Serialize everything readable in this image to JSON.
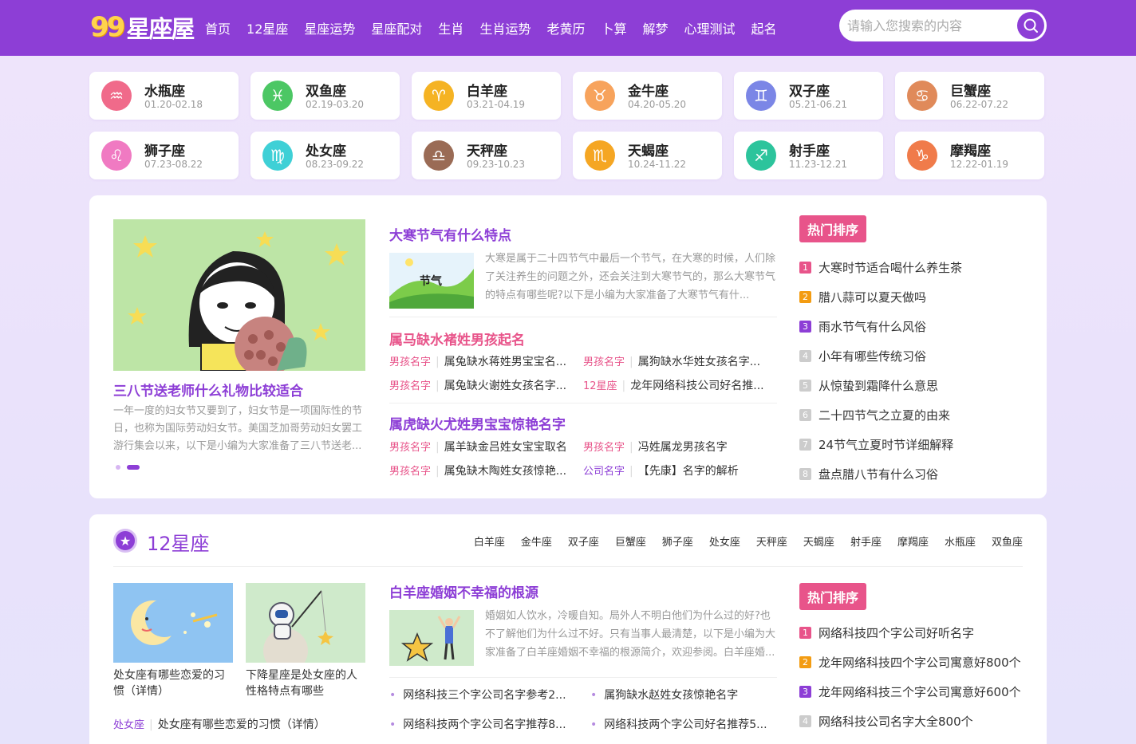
{
  "header": {
    "logo_num": "99",
    "logo_text": "星座屋",
    "nav": [
      "首页",
      "12星座",
      "星座运势",
      "星座配对",
      "生肖",
      "生肖运势",
      "老黄历",
      "卜算",
      "解梦",
      "心理测试",
      "起名"
    ],
    "search_placeholder": "请输入您搜索的内容"
  },
  "zodiac": [
    {
      "name": "水瓶座",
      "date": "01.20-02.18",
      "color": "#f06a8a",
      "glyph": "♒"
    },
    {
      "name": "双鱼座",
      "date": "02.19-03.20",
      "color": "#4cc764",
      "glyph": "♓"
    },
    {
      "name": "白羊座",
      "date": "03.21-04.19",
      "color": "#f5b323",
      "glyph": "♈"
    },
    {
      "name": "金牛座",
      "date": "04.20-05.20",
      "color": "#f7a35c",
      "glyph": "♉"
    },
    {
      "name": "双子座",
      "date": "05.21-06.21",
      "color": "#7b86e6",
      "glyph": "♊"
    },
    {
      "name": "巨蟹座",
      "date": "06.22-07.22",
      "color": "#e08a5a",
      "glyph": "♋"
    },
    {
      "name": "狮子座",
      "date": "07.23-08.22",
      "color": "#f07ac2",
      "glyph": "♌"
    },
    {
      "name": "处女座",
      "date": "08.23-09.22",
      "color": "#3fd0d6",
      "glyph": "♍"
    },
    {
      "name": "天秤座",
      "date": "09.23-10.23",
      "color": "#9a6b55",
      "glyph": "♎"
    },
    {
      "name": "天蝎座",
      "date": "10.24-11.22",
      "color": "#f5a623",
      "glyph": "♏"
    },
    {
      "name": "射手座",
      "date": "11.23-12.21",
      "color": "#2cc49c",
      "glyph": "♐"
    },
    {
      "name": "摩羯座",
      "date": "12.22-01.19",
      "color": "#f07b4a",
      "glyph": "♑"
    }
  ],
  "featured": {
    "title": "三八节送老师什么礼物比较适合",
    "desc": "一年一度的妇女节又要到了，妇女节是一项国际性的节日，也称为国际劳动妇女节。美国芝加哥劳动妇女罢工游行集会以来，以下是小编为大家准备了三八节送老..."
  },
  "articles": {
    "a1": {
      "title": "大寒节气有什么特点",
      "desc": "大寒是属于二十四节气中最后一个节气，在大寒的时候，人们除了关注养生的问题之外，还会关注到大寒节气的，那么大寒节气的特点有哪些呢?以下是小编为大家准备了大寒节气有什..."
    },
    "a2": {
      "title": "属马缺水褚姓男孩起名"
    },
    "a2_rows": [
      [
        {
          "tag": "男孩名字",
          "text": "属兔缺水蒋姓男宝宝名..."
        },
        {
          "tag": "男孩名字",
          "text": "属狗缺水华姓女孩名字..."
        }
      ],
      [
        {
          "tag": "男孩名字",
          "text": "属兔缺火谢姓女孩名字..."
        },
        {
          "tag": "12星座",
          "text": "龙年网络科技公司好名推..."
        }
      ]
    ],
    "a3": {
      "title": "属虎缺火尤姓男宝宝惊艳名字"
    },
    "a3_rows": [
      [
        {
          "tag": "男孩名字",
          "text": "属羊缺金吕姓女宝宝取名"
        },
        {
          "tag": "男孩名字",
          "text": "冯姓属龙男孩名字"
        }
      ],
      [
        {
          "tag": "男孩名字",
          "text": "属兔缺木陶姓女孩惊艳..."
        },
        {
          "tag": "公司名字",
          "text": "【先康】名字的解析"
        }
      ]
    ]
  },
  "hot1": {
    "badge": "热门排序",
    "items": [
      "大寒时节适合喝什么养生茶",
      "腊八蒜可以夏天做吗",
      "雨水节气有什么风俗",
      "小年有哪些传统习俗",
      "从惊蛰到霜降什么意思",
      "二十四节气之立夏的由来",
      "24节气立夏时节详细解释",
      "盘点腊八节有什么习俗"
    ]
  },
  "section2": {
    "title": "12星座",
    "links": [
      "白羊座",
      "金牛座",
      "双子座",
      "巨蟹座",
      "狮子座",
      "处女座",
      "天秤座",
      "天蝎座",
      "射手座",
      "摩羯座",
      "水瓶座",
      "双鱼座"
    ],
    "cards": [
      {
        "title": "处女座有哪些恋爱的习惯（详情）"
      },
      {
        "title": "下降星座是处女座的人性格特点有哪些"
      }
    ],
    "tagline": {
      "tag": "处女座",
      "text": "处女座有哪些恋爱的习惯（详情）"
    },
    "main": {
      "title": "白羊座婚姻不幸福的根源",
      "desc": "婚姻如人饮水，冷暖自知。局外人不明白他们为什么过的好?也不了解他们为什么过不好。只有当事人最清楚，以下是小编为大家准备了白羊座婚姻不幸福的根源简介，欢迎参阅。白羊座婚..."
    },
    "bullets": [
      "网络科技三个字公司名字参考2...",
      "属狗缺水赵姓女孩惊艳名字",
      "网络科技两个字公司名字推荐8...",
      "网络科技两个字公司好名推荐5..."
    ]
  },
  "hot2": {
    "badge": "热门排序",
    "items": [
      "网络科技四个字公司好听名字",
      "龙年网络科技四个字公司寓意好800个",
      "龙年网络科技三个字公司寓意好600个",
      "网络科技公司名字大全800个"
    ]
  }
}
